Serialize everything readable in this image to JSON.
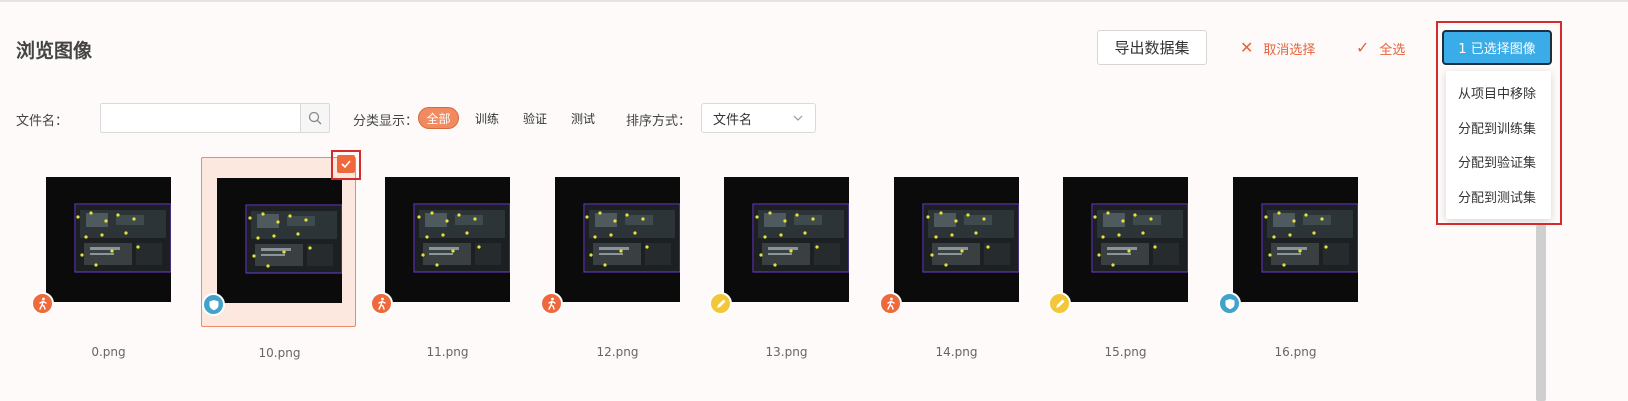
{
  "header": {
    "title": "浏览图像",
    "export_label": "导出数据集",
    "cancel_selection_label": "取消选择",
    "select_all_label": "全选",
    "selected_count_label": "1 已选择图像"
  },
  "selection_menu": {
    "items": [
      "从项目中移除",
      "分配到训练集",
      "分配到验证集",
      "分配到测试集"
    ]
  },
  "filters": {
    "filename_label": "文件名：",
    "filename_value": "",
    "category_label": "分类显示：",
    "categories": [
      "全部",
      "训练",
      "验证",
      "测试"
    ],
    "active_category": "全部",
    "sort_label": "排序方式：",
    "sort_value": "文件名"
  },
  "images": [
    {
      "name": "0.png",
      "split": "训练",
      "selected": false
    },
    {
      "name": "10.png",
      "split": "验证",
      "selected": true
    },
    {
      "name": "11.png",
      "split": "训练",
      "selected": false
    },
    {
      "name": "12.png",
      "split": "训练",
      "selected": false
    },
    {
      "name": "13.png",
      "split": "测试",
      "selected": false
    },
    {
      "name": "14.png",
      "split": "训练",
      "selected": false
    },
    {
      "name": "15.png",
      "split": "测试",
      "selected": false
    },
    {
      "name": "16.png",
      "split": "验证",
      "selected": false
    }
  ],
  "colors": {
    "accent": "#ee6a3c",
    "primary": "#3aace8",
    "train_badge": "#ee6a3c",
    "val_badge": "#41a3cc",
    "test_badge": "#f3c73a",
    "highlight": "#d52b2b"
  },
  "icons": {
    "search": "search-icon",
    "cancel": "close-icon",
    "select_all": "check-icon",
    "sort": "chevron-down-icon",
    "train": "runner-icon",
    "val": "shield-icon",
    "test": "pencil-icon"
  }
}
